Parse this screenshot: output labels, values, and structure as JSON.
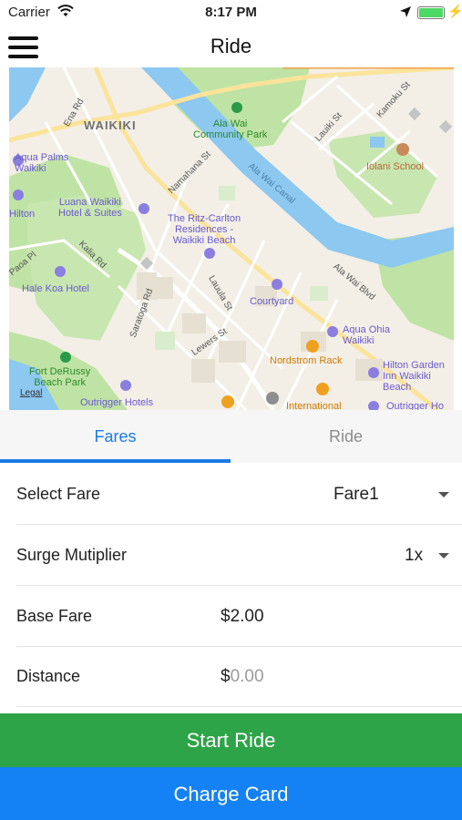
{
  "status_bar": {
    "carrier": "Carrier",
    "time": "8:17 PM",
    "icons": [
      "wifi-icon",
      "location-arrow-icon",
      "battery-icon",
      "charging-bolt-icon"
    ]
  },
  "nav": {
    "title": "Ride",
    "menu_icon": "hamburger-menu-icon"
  },
  "map": {
    "labels": {
      "ena_rd": "Ena Rd",
      "waikiki": "WAIKIKI",
      "ala_wai_park": "Ala Wai\nCommunity Park",
      "lauiki_st": "Lauiki St",
      "kamoku_st": "Kamoku St",
      "iolani": "Iolani School",
      "aqua_palms": "Aqua Palms\nWaikiki",
      "hilton": "Hilton",
      "namahana_st": "Namahana St",
      "ala_wai_canal": "Ala Wai Canal",
      "luana": "Luana Waikiki\nHotel & Suites",
      "ritz": "The Ritz-Carlton\nResidences -\nWaikiki Beach",
      "kalia_rd": "Kalia Rd",
      "paoa_pl": "Paoa Pl",
      "hale_koa": "Hale Koa Hotel",
      "saratoga_rd": "Saratoga Rd",
      "lauula_st": "Lauula St",
      "courtyard": "Courtyard",
      "ala_wai_blvd": "Ala Wai Blvd",
      "aqua_ohia": "Aqua Ohia\nWaikiki",
      "lewers_st": "Lewers St",
      "nordstrom": "Nordstrom Rack",
      "hilton_garden": "Hilton Garden\nInn Waikiki\nBeach",
      "fort_derussy": "Fort DeRussy\nBeach Park",
      "outrigger_hotels": "Outrigger Hotels",
      "international": "International",
      "outrigger_ho": "Outrigger Ho",
      "legal": "Legal"
    }
  },
  "tabs": {
    "fares": "Fares",
    "ride": "Ride",
    "active": "Fares"
  },
  "form": {
    "select_fare": {
      "label": "Select Fare",
      "value": "Fare1"
    },
    "surge": {
      "label": "Surge Mutiplier",
      "value": "1x"
    },
    "base_fare": {
      "label": "Base Fare",
      "value": "$2.00"
    },
    "distance": {
      "label": "Distance",
      "currency": "$",
      "placeholder": "0.00"
    }
  },
  "buttons": {
    "start_ride": "Start Ride",
    "charge_card": "Charge Card"
  },
  "colors": {
    "accent_blue": "#1a7ae6",
    "start_green": "#2ea448",
    "charge_blue": "#1482f5"
  }
}
